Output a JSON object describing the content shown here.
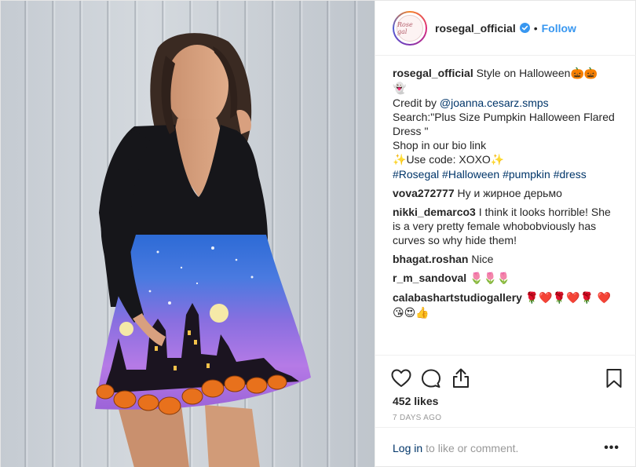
{
  "post": {
    "account": {
      "handle": "rosegal_official",
      "avatar_text": "Rose gal",
      "verified_icon": "verified-badge-icon",
      "separator": "•",
      "follow_label": "Follow"
    },
    "caption": {
      "user": "rosegal_official",
      "line1": "Style on Halloween",
      "line1_emoji": "🎃🎃",
      "ghost_emoji": "👻",
      "credit_prefix": "Credit by ",
      "credit_handle": "@joanna.cesarz.smps",
      "search_text": "Search:\"Plus Size Pumpkin Halloween Flared Dress \"",
      "shop_text": "Shop in our bio link",
      "code_sparkle_left": "✨",
      "code_text": "Use code: XOXO",
      "code_sparkle_right": "✨",
      "hashtags": [
        "#Rosegal",
        "#Halloween",
        "#pumpkin",
        "#dress"
      ]
    },
    "comments": [
      {
        "user": "vova272777",
        "text": "Ну и жирное дерьмо"
      },
      {
        "user": "nikki_demarco3",
        "text": "I think it looks horrible! She is a very pretty female whobobviously has curves so why hide them!"
      },
      {
        "user": "bhagat.roshan",
        "text": "Nice"
      },
      {
        "user": "r_m_sandoval",
        "text": "🌷🌷🌷"
      },
      {
        "user": "calabashartstudiogallery",
        "text": "🌹❤️🌹❤️🌹 ❤️😘😍👍"
      }
    ],
    "actions": {
      "like_icon": "heart-icon",
      "comment_icon": "comment-bubble-icon",
      "share_icon": "share-icon",
      "save_icon": "bookmark-icon"
    },
    "likes_text": "452 likes",
    "time_ago": "7 DAYS AGO",
    "login": {
      "link": "Log in",
      "rest": "to like or comment.",
      "more_icon": "more-options-icon",
      "more_text": "•••"
    }
  },
  "colors": {
    "link_blue": "#3897f0",
    "dark_link": "#003569",
    "text": "#262626",
    "muted": "#999999",
    "divider": "#efefef"
  }
}
